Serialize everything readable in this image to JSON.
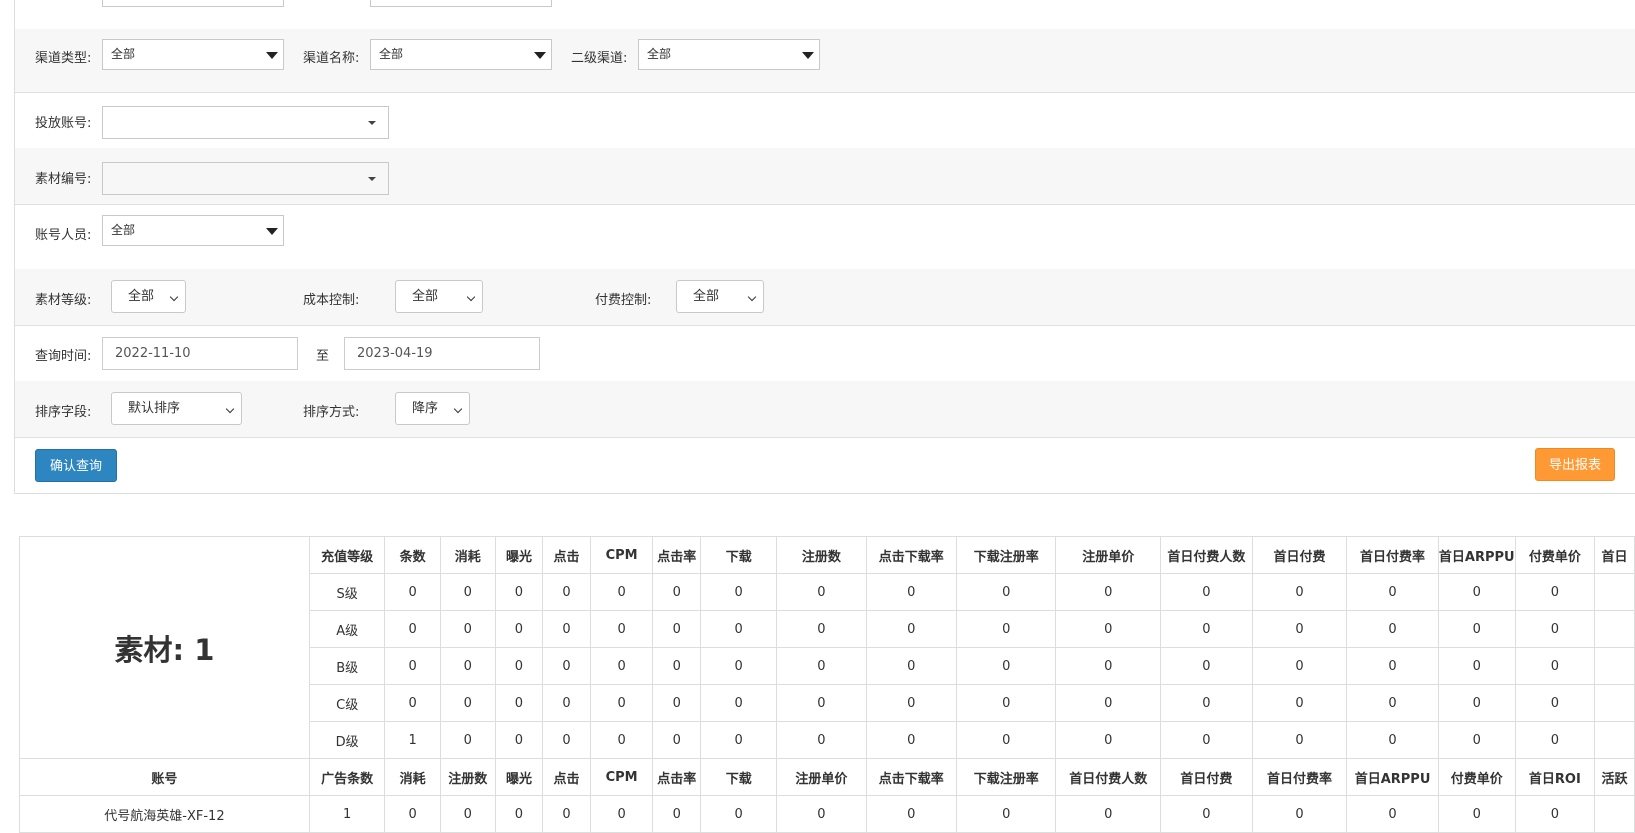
{
  "filters": {
    "channel_type": {
      "label": "渠道类型:",
      "value": "全部"
    },
    "channel_name": {
      "label": "渠道名称:",
      "value": "全部"
    },
    "sub_channel": {
      "label": "二级渠道:",
      "value": "全部"
    },
    "account": {
      "label": "投放账号:",
      "value": ""
    },
    "material_no": {
      "label": "素材编号:",
      "value": ""
    },
    "account_staff": {
      "label": "账号人员:",
      "value": "全部"
    },
    "material_level": {
      "label": "素材等级:",
      "value": "全部"
    },
    "cost_control": {
      "label": "成本控制:",
      "value": "全部"
    },
    "pay_control": {
      "label": "付费控制:",
      "value": "全部"
    },
    "query_time": {
      "label": "查询时间:",
      "from": "2022-11-10",
      "to_label": "至",
      "to": "2023-04-19"
    },
    "sort_field": {
      "label": "排序字段:",
      "value": "默认排序"
    },
    "sort_order": {
      "label": "排序方式:",
      "value": "降序"
    }
  },
  "buttons": {
    "confirm": "确认查询",
    "export": "导出报表"
  },
  "summary": {
    "material_title": "素材: 1",
    "headers": [
      "充值等级",
      "条数",
      "消耗",
      "曝光",
      "点击",
      "CPM",
      "点击率",
      "下载",
      "注册数",
      "点击下载率",
      "下载注册率",
      "注册单价",
      "首日付费人数",
      "首日付费",
      "首日付费率",
      "首日ARPPU",
      "付费单价",
      "首日"
    ],
    "rows": [
      [
        "S级",
        "0",
        "0",
        "0",
        "0",
        "0",
        "0",
        "0",
        "0",
        "0",
        "0",
        "0",
        "0",
        "0",
        "0",
        "0",
        "0",
        ""
      ],
      [
        "A级",
        "0",
        "0",
        "0",
        "0",
        "0",
        "0",
        "0",
        "0",
        "0",
        "0",
        "0",
        "0",
        "0",
        "0",
        "0",
        "0",
        ""
      ],
      [
        "B级",
        "0",
        "0",
        "0",
        "0",
        "0",
        "0",
        "0",
        "0",
        "0",
        "0",
        "0",
        "0",
        "0",
        "0",
        "0",
        "0",
        ""
      ],
      [
        "C级",
        "0",
        "0",
        "0",
        "0",
        "0",
        "0",
        "0",
        "0",
        "0",
        "0",
        "0",
        "0",
        "0",
        "0",
        "0",
        "0",
        ""
      ],
      [
        "D级",
        "1",
        "0",
        "0",
        "0",
        "0",
        "0",
        "0",
        "0",
        "0",
        "0",
        "0",
        "0",
        "0",
        "0",
        "0",
        "0",
        ""
      ]
    ]
  },
  "detail": {
    "headers": [
      "账号",
      "广告条数",
      "消耗",
      "注册数",
      "曝光",
      "点击",
      "CPM",
      "点击率",
      "下载",
      "注册单价",
      "点击下载率",
      "下载注册率",
      "首日付费人数",
      "首日付费",
      "首日付费率",
      "首日ARPPU",
      "付费单价",
      "首日ROI",
      "活跃"
    ],
    "rows": [
      [
        "代号航海英雄-XF-12",
        "1",
        "0",
        "0",
        "0",
        "0",
        "0",
        "0",
        "0",
        "0",
        "0",
        "0",
        "0",
        "0",
        "0",
        "0",
        "0",
        "0",
        ""
      ]
    ]
  }
}
